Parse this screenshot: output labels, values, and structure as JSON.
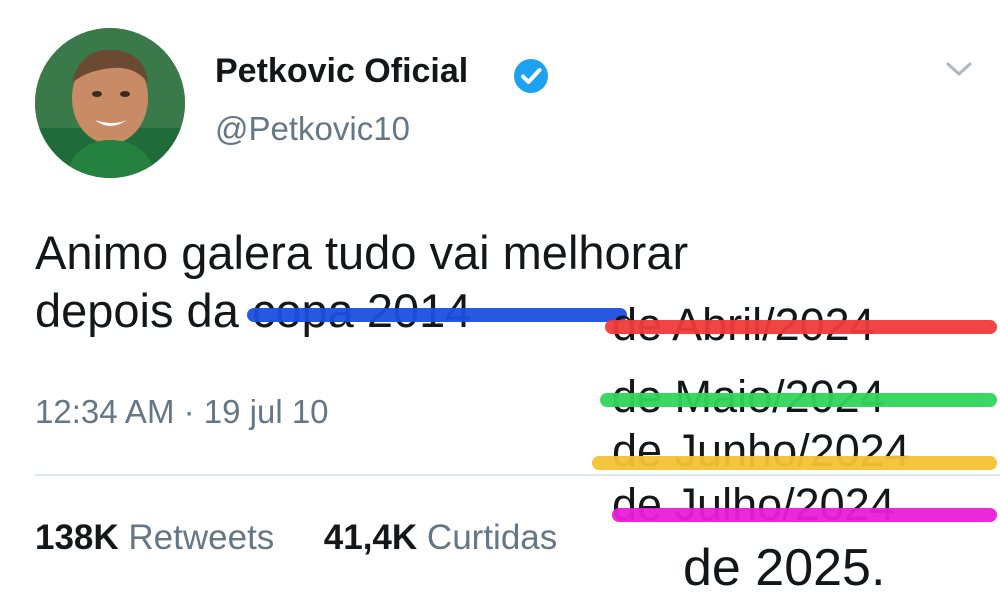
{
  "profile": {
    "display_name": "Petkovic Oficial",
    "handle": "@Petkovic10",
    "verified": true,
    "avatar_icon": "profile-photo"
  },
  "tweet": {
    "line1": "Animo galera tudo vai melhorar",
    "line2": "depois da copa 2014",
    "timestamp": "12:34 AM · 19 jul 10"
  },
  "stats": {
    "retweets_count": "138K",
    "retweets_label": "Retweets",
    "likes_count": "41,4K",
    "likes_label": "Curtidas"
  },
  "edits": [
    {
      "text": "de Abril/2024",
      "strike_color": "#f03a3a"
    },
    {
      "text": "de Maio/2024",
      "strike_color": "#2fd65a"
    },
    {
      "text": "de Junho/2024",
      "strike_color": "#f6c235"
    },
    {
      "text": "de Julho/2024",
      "strike_color": "#ea1ed8"
    }
  ],
  "original_strike_color": "#1b4fe0",
  "final_edit": "de 2025.",
  "colors": {
    "verified_blue": "#1da1f2",
    "secondary_text": "#657786",
    "primary_text": "#14171a"
  },
  "icons": {
    "verified": "verified-badge-icon",
    "menu": "chevron-down-icon"
  }
}
